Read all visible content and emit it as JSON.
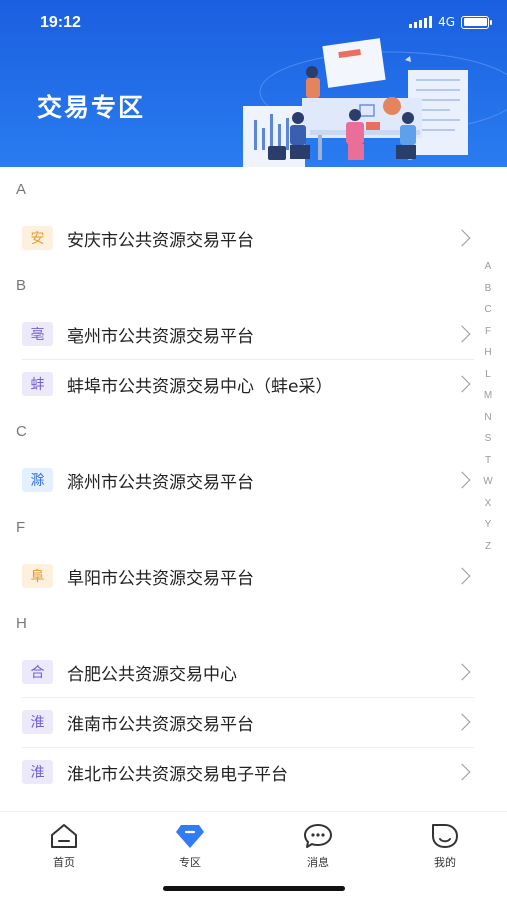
{
  "status": {
    "time": "19:12",
    "network": "4G"
  },
  "header": {
    "title": "交易专区"
  },
  "sections": [
    {
      "letter": "A",
      "items": [
        {
          "badge": "安",
          "color": "orange",
          "label": "安庆市公共资源交易平台"
        }
      ]
    },
    {
      "letter": "B",
      "items": [
        {
          "badge": "亳",
          "color": "purple",
          "label": "亳州市公共资源交易平台"
        },
        {
          "badge": "蚌",
          "color": "purple",
          "label": "蚌埠市公共资源交易中心（蚌e采）"
        }
      ]
    },
    {
      "letter": "C",
      "items": [
        {
          "badge": "滁",
          "color": "blue",
          "label": "滁州市公共资源交易平台"
        }
      ]
    },
    {
      "letter": "F",
      "items": [
        {
          "badge": "阜",
          "color": "orange",
          "label": "阜阳市公共资源交易平台"
        }
      ]
    },
    {
      "letter": "H",
      "items": [
        {
          "badge": "合",
          "color": "purple",
          "label": "合肥公共资源交易中心"
        },
        {
          "badge": "淮",
          "color": "purple",
          "label": "淮南市公共资源交易平台"
        },
        {
          "badge": "淮",
          "color": "purple",
          "label": "淮北市公共资源交易电子平台"
        }
      ]
    }
  ],
  "alpha_index": [
    "A",
    "B",
    "C",
    "F",
    "H",
    "L",
    "M",
    "N",
    "S",
    "T",
    "W",
    "X",
    "Y",
    "Z"
  ],
  "tabs": [
    {
      "label": "首页",
      "icon": "home-icon"
    },
    {
      "label": "专区",
      "icon": "diamond-icon"
    },
    {
      "label": "消息",
      "icon": "chat-bubble-icon"
    },
    {
      "label": "我的",
      "icon": "user-face-icon"
    }
  ],
  "colors": {
    "header_blue": "#1a5fe0",
    "tab_active": "#2f7cf6",
    "badge_orange": "#e89a2e",
    "badge_purple": "#6f5fd6",
    "badge_blue": "#2f6fe0"
  }
}
